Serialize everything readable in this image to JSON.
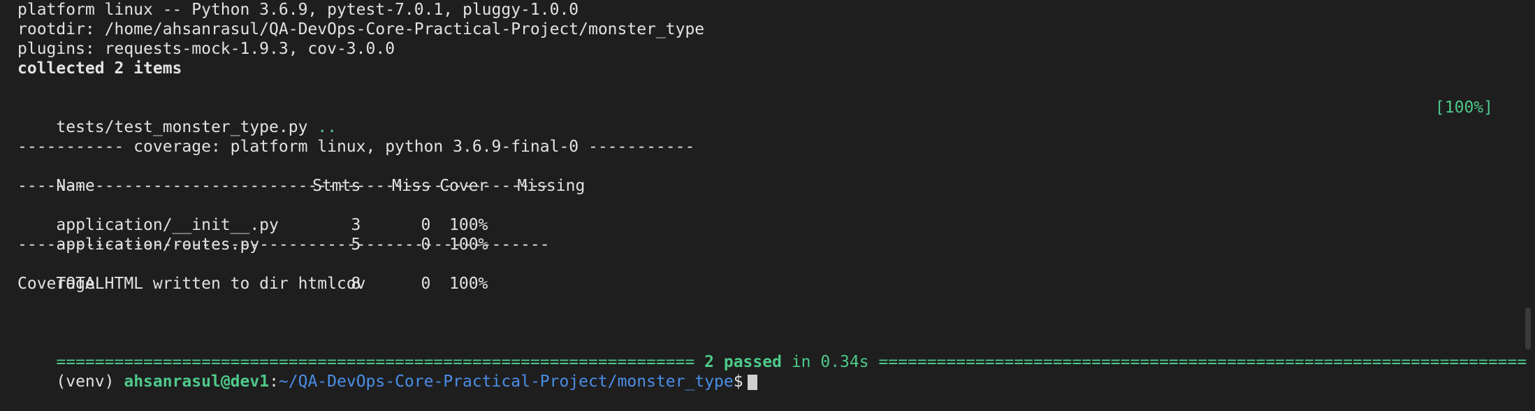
{
  "header": {
    "platform_line": "platform linux -- Python 3.6.9, pytest-7.0.1, pluggy-1.0.0",
    "rootdir_line": "rootdir: /home/ahsanrasul/QA-DevOps-Core-Practical-Project/monster_type",
    "plugins_line": "plugins: requests-mock-1.9.3, cov-3.0.0",
    "collected_line": "collected 2 items"
  },
  "test_run": {
    "file": "tests/test_monster_type.py",
    "dots": "..",
    "percent": "[100%]"
  },
  "coverage": {
    "title_line": "----------- coverage: platform linux, python 3.6.9-final-0 -----------",
    "columns": {
      "name": "Name",
      "stmts": "Stmts",
      "miss": "Miss",
      "cover": "Cover",
      "missing": "Missing"
    },
    "separator": "-------------------------------------------------------",
    "rows": [
      {
        "name": "application/__init__.py",
        "stmts": "3",
        "miss": "0",
        "cover": "100%"
      },
      {
        "name": "application/routes.py",
        "stmts": "5",
        "miss": "0",
        "cover": "100%"
      }
    ],
    "total": {
      "name": "TOTAL",
      "stmts": "8",
      "miss": "0",
      "cover": "100%"
    },
    "html_note": "Coverage HTML written to dir htmlcov"
  },
  "summary": {
    "left_rule": "==================================================================",
    "passed": "2 passed",
    "timing": "in 0.34s",
    "right_rule": "==================================================================="
  },
  "prompt": {
    "venv": "(venv)",
    "user_host": "ahsanrasul@dev1",
    "colon": ":",
    "path": "~/QA-DevOps-Core-Practical-Project/monster_type",
    "symbol": "$"
  },
  "colors": {
    "background": "#1e1e1e",
    "foreground": "#e2e2e2",
    "green": "#4ec98a",
    "blue": "#4b8ee8"
  }
}
